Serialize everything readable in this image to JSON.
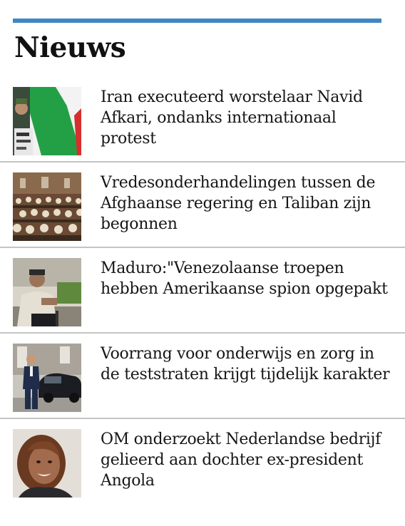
{
  "section": {
    "title": "Nieuws",
    "accent_color": "#3f86c4"
  },
  "news": [
    {
      "headline": "Iran executeerd worstelaar Navid Afkari, ondanks internationaal protest",
      "thumbnail": "iran-protest-flag-photo"
    },
    {
      "headline": "Vredesonderhandelingen tussen de Afghaanse regering en Taliban zijn begonnen",
      "thumbnail": "conference-hall-delegates-photo"
    },
    {
      "headline": "Maduro:\"Venezolaanse troepen hebben Amerikaanse spion opgepakt",
      "thumbnail": "maduro-speaking-photo"
    },
    {
      "headline": "Voorrang voor onderwijs en zorg in de teststraten krijgt tijdelijk karakter",
      "thumbnail": "man-beside-car-photo"
    },
    {
      "headline": "OM onderzoekt Nederlandse bedrijf gelieerd aan dochter ex-president Angola",
      "thumbnail": "woman-portrait-photo"
    }
  ]
}
